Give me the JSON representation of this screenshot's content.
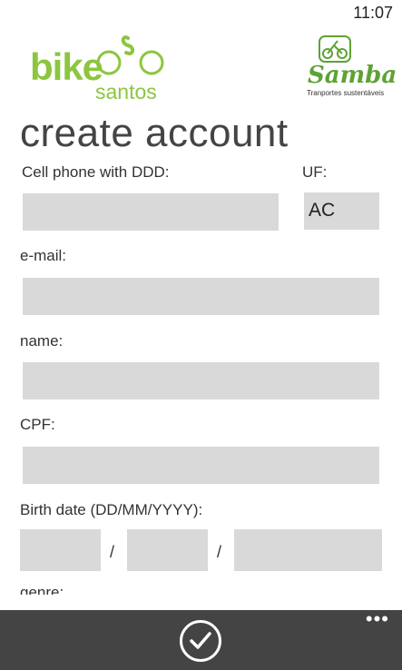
{
  "status": {
    "time": "11:07"
  },
  "header": {
    "logo_left": {
      "word1": "bike",
      "word2": "santos",
      "color": "#8cc63f"
    },
    "logo_right": {
      "name": "Samba",
      "tagline": "Tranportes sustentáveis",
      "color": "#5ea234"
    }
  },
  "page": {
    "title": "create account"
  },
  "form": {
    "cell_phone_label": "Cell phone with DDD:",
    "cell_phone_value": "",
    "uf_label": "UF:",
    "uf_value": "AC",
    "email_label": "e-mail:",
    "email_value": "",
    "name_label": "name:",
    "name_value": "",
    "cpf_label": "CPF:",
    "cpf_value": "",
    "birth_label": "Birth date (DD/MM/YYYY):",
    "birth_separator": "/",
    "birth_day": "",
    "birth_month": "",
    "birth_year": "",
    "genre_label": "genre:"
  },
  "app_bar": {
    "confirm_icon": "check-circle-icon",
    "more_icon": "more-dots-icon",
    "more_label": "•••"
  },
  "colors": {
    "field_bg": "#d9d9d9",
    "app_bar_bg": "#444444",
    "accent_green": "#8cc63f"
  }
}
